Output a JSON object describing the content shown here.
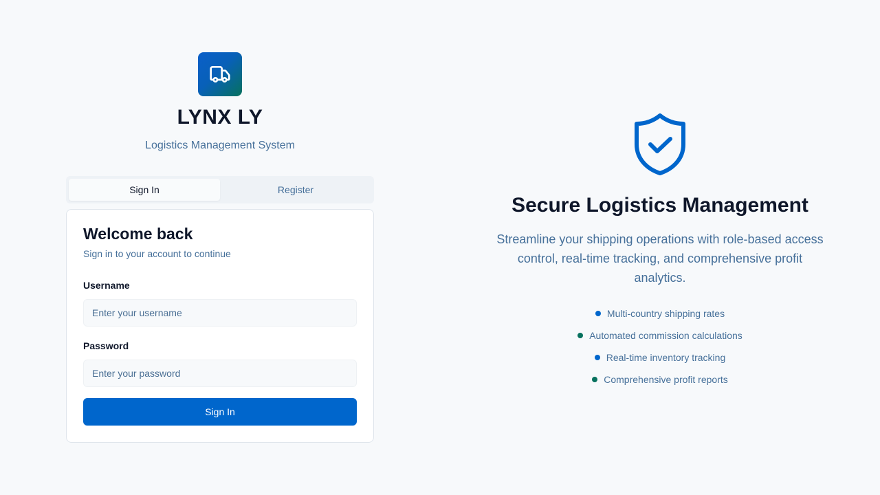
{
  "brand": {
    "icon": "truck-icon",
    "title": "LYNX LY",
    "subtitle": "Logistics Management System"
  },
  "tabs": [
    {
      "label": "Sign In",
      "active": true
    },
    {
      "label": "Register",
      "active": false
    }
  ],
  "login": {
    "title": "Welcome back",
    "subtitle": "Sign in to your account to continue",
    "username_label": "Username",
    "username_placeholder": "Enter your username",
    "username_value": "",
    "password_label": "Password",
    "password_placeholder": "Enter your password",
    "password_value": "",
    "submit_label": "Sign In"
  },
  "hero": {
    "icon": "shield-check-icon",
    "title": "Secure Logistics Management",
    "description": "Streamline your shipping operations with role-based access control, real-time tracking, and comprehensive profit analytics.",
    "features": [
      {
        "label": "Multi-country shipping rates",
        "dot_color": "#0066cc"
      },
      {
        "label": "Automated commission calculations",
        "dot_color": "#07715e"
      },
      {
        "label": "Real-time inventory tracking",
        "dot_color": "#0066cc"
      },
      {
        "label": "Comprehensive profit reports",
        "dot_color": "#07715e"
      }
    ]
  },
  "colors": {
    "primary": "#0066cc",
    "secondary": "#07715e",
    "background": "#f7f9fb",
    "muted_text": "#46709a"
  }
}
